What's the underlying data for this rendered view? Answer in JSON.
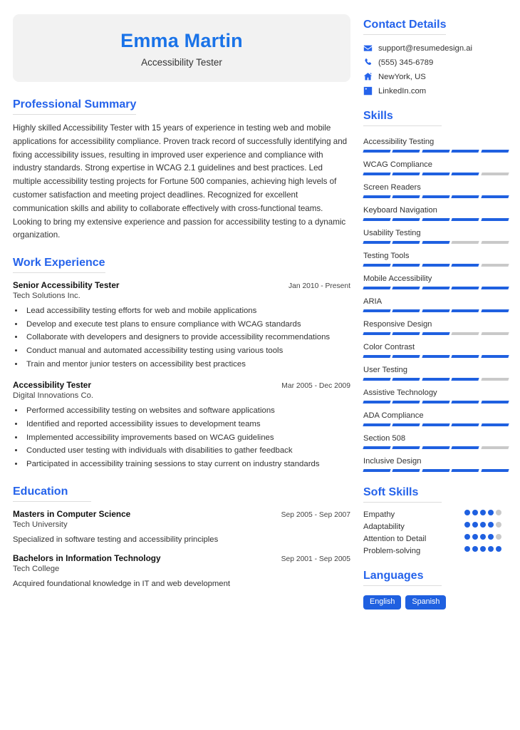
{
  "theme": {
    "accent": "#2563eb",
    "bar_fill": "#1f60e0",
    "bar_empty": "#c9c9c9",
    "card_bg": "#f2f2f2",
    "text": "#333333"
  },
  "header": {
    "name": "Emma Martin",
    "role": "Accessibility Tester"
  },
  "summary": {
    "heading": "Professional Summary",
    "text": "Highly skilled Accessibility Tester with 15 years of experience in testing web and mobile applications for accessibility compliance. Proven track record of successfully identifying and fixing accessibility issues, resulting in improved user experience and compliance with industry standards. Strong expertise in WCAG 2.1 guidelines and best practices. Led multiple accessibility testing projects for Fortune 500 companies, achieving high levels of customer satisfaction and meeting project deadlines. Recognized for excellent communication skills and ability to collaborate effectively with cross-functional teams. Looking to bring my extensive experience and passion for accessibility testing to a dynamic organization."
  },
  "experience": {
    "heading": "Work Experience",
    "entries": [
      {
        "title": "Senior Accessibility Tester",
        "date": "Jan 2010 - Present",
        "org": "Tech Solutions Inc.",
        "bullets": [
          "Lead accessibility testing efforts for web and mobile applications",
          "Develop and execute test plans to ensure compliance with WCAG standards",
          "Collaborate with developers and designers to provide accessibility recommendations",
          "Conduct manual and automated accessibility testing using various tools",
          "Train and mentor junior testers on accessibility best practices"
        ]
      },
      {
        "title": "Accessibility Tester",
        "date": "Mar 2005 - Dec 2009",
        "org": "Digital Innovations Co.",
        "bullets": [
          "Performed accessibility testing on websites and software applications",
          "Identified and reported accessibility issues to development teams",
          "Implemented accessibility improvements based on WCAG guidelines",
          "Conducted user testing with individuals with disabilities to gather feedback",
          "Participated in accessibility training sessions to stay current on industry standards"
        ]
      }
    ]
  },
  "education": {
    "heading": "Education",
    "entries": [
      {
        "title": "Masters in Computer Science",
        "date": "Sep 2005 - Sep 2007",
        "org": "Tech University",
        "note": "Specialized in software testing and accessibility principles"
      },
      {
        "title": "Bachelors in Information Technology",
        "date": "Sep 2001 - Sep 2005",
        "org": "Tech College",
        "note": "Acquired foundational knowledge in IT and web development"
      }
    ]
  },
  "contact": {
    "heading": "Contact Details",
    "items": [
      {
        "icon": "envelope-icon",
        "value": "support@resumedesign.ai"
      },
      {
        "icon": "phone-icon",
        "value": "(555) 345-6789"
      },
      {
        "icon": "home-icon",
        "value": "NewYork, US"
      },
      {
        "icon": "linkedin-icon",
        "value": "LinkedIn.com"
      }
    ]
  },
  "skills": {
    "heading": "Skills",
    "max_level": 5,
    "items": [
      {
        "name": "Accessibility Testing",
        "level": 5
      },
      {
        "name": "WCAG Compliance",
        "level": 4
      },
      {
        "name": "Screen Readers",
        "level": 5
      },
      {
        "name": "Keyboard Navigation",
        "level": 5
      },
      {
        "name": "Usability Testing",
        "level": 3
      },
      {
        "name": "Testing Tools",
        "level": 4
      },
      {
        "name": "Mobile Accessibility",
        "level": 5
      },
      {
        "name": "ARIA",
        "level": 5
      },
      {
        "name": "Responsive Design",
        "level": 3
      },
      {
        "name": "Color Contrast",
        "level": 5
      },
      {
        "name": "User Testing",
        "level": 4
      },
      {
        "name": "Assistive Technology",
        "level": 5
      },
      {
        "name": "ADA Compliance",
        "level": 5
      },
      {
        "name": "Section 508",
        "level": 4
      },
      {
        "name": "Inclusive Design",
        "level": 5
      }
    ]
  },
  "soft_skills": {
    "heading": "Soft Skills",
    "max_level": 5,
    "items": [
      {
        "name": "Empathy",
        "level": 4
      },
      {
        "name": "Adaptability",
        "level": 4
      },
      {
        "name": "Attention to Detail",
        "level": 4
      },
      {
        "name": "Problem-solving",
        "level": 5
      }
    ]
  },
  "languages": {
    "heading": "Languages",
    "items": [
      "English",
      "Spanish"
    ]
  }
}
